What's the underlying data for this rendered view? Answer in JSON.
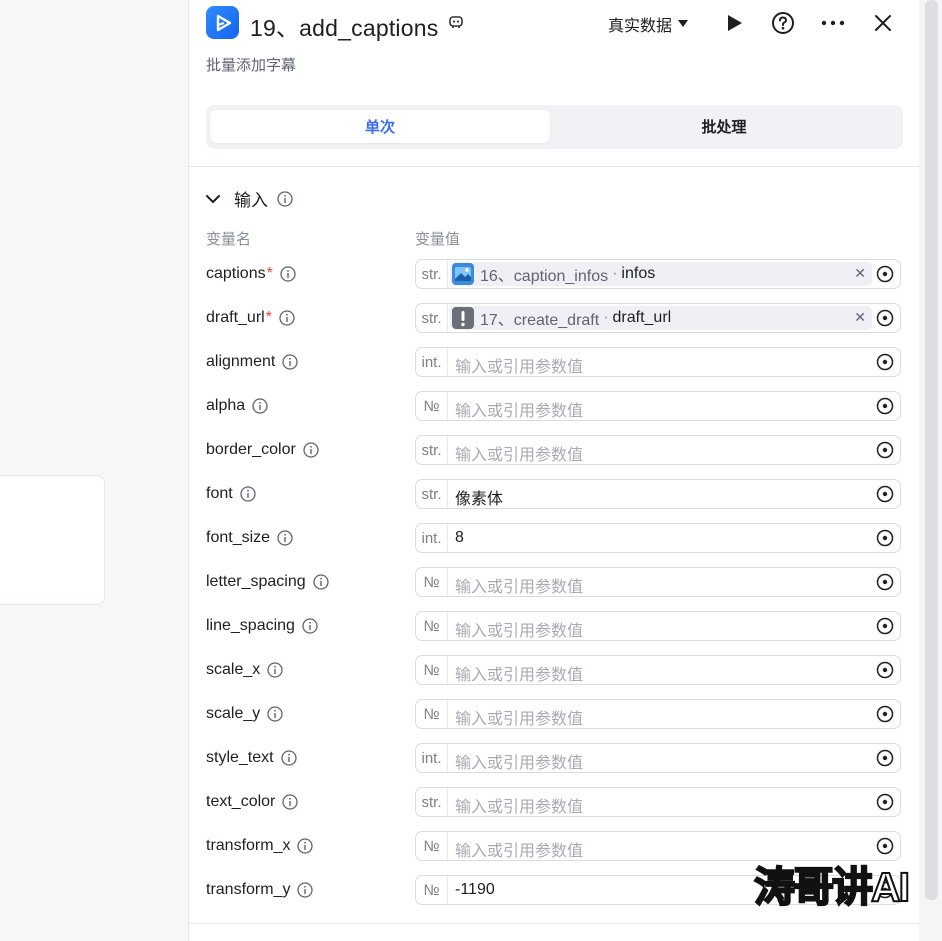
{
  "header": {
    "title": "19、add_captions",
    "subtitle": "批量添加字幕",
    "data_mode": "真实数据"
  },
  "tabs": [
    {
      "label": "单次",
      "active": true
    },
    {
      "label": "批处理",
      "active": false
    }
  ],
  "input_section": {
    "title": "输入",
    "col_name": "变量名",
    "col_value": "变量值",
    "placeholder": "输入或引用参数值",
    "rows": [
      {
        "name": "captions",
        "required": true,
        "type": "str.",
        "ref": {
          "node": "16、caption_infos",
          "field": "infos",
          "icon": "node-image-icon"
        }
      },
      {
        "name": "draft_url",
        "required": true,
        "type": "str.",
        "ref": {
          "node": "17、create_draft",
          "field": "draft_url",
          "icon": "warning-icon"
        }
      },
      {
        "name": "alignment",
        "type": "int."
      },
      {
        "name": "alpha",
        "type": "№"
      },
      {
        "name": "border_color",
        "type": "str."
      },
      {
        "name": "font",
        "type": "str.",
        "value": "像素体"
      },
      {
        "name": "font_size",
        "type": "int.",
        "value": "8"
      },
      {
        "name": "letter_spacing",
        "type": "№"
      },
      {
        "name": "line_spacing",
        "type": "№"
      },
      {
        "name": "scale_x",
        "type": "№"
      },
      {
        "name": "scale_y",
        "type": "№"
      },
      {
        "name": "style_text",
        "type": "int."
      },
      {
        "name": "text_color",
        "type": "str."
      },
      {
        "name": "transform_x",
        "type": "№"
      },
      {
        "name": "transform_y",
        "type": "№",
        "value": "-1190"
      }
    ]
  },
  "watermark": "涛哥讲AI",
  "colors": {
    "accent": "#3a6cf6",
    "required": "#f0413d",
    "app_icon": "#1e6ef5"
  }
}
